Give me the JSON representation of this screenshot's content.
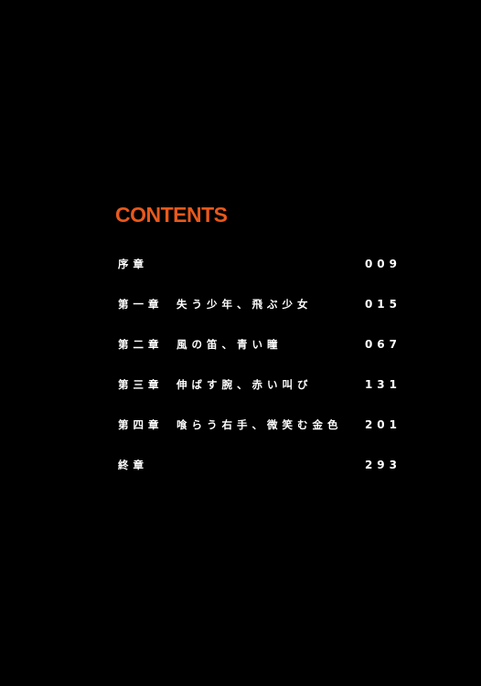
{
  "heading": "CONTENTS",
  "accent_color": "#e8591c",
  "toc": [
    {
      "chapter": "序章",
      "title": "",
      "page": "009"
    },
    {
      "chapter": "第一章",
      "title": "失う少年、飛ぶ少女",
      "page": "015"
    },
    {
      "chapter": "第二章",
      "title": "風の笛、青い瞳",
      "page": "067"
    },
    {
      "chapter": "第三章",
      "title": "伸ばす腕、赤い叫び",
      "page": "131"
    },
    {
      "chapter": "第四章",
      "title": "喰らう右手、微笑む金色",
      "page": "201"
    },
    {
      "chapter": "終章",
      "title": "",
      "page": "293"
    }
  ]
}
